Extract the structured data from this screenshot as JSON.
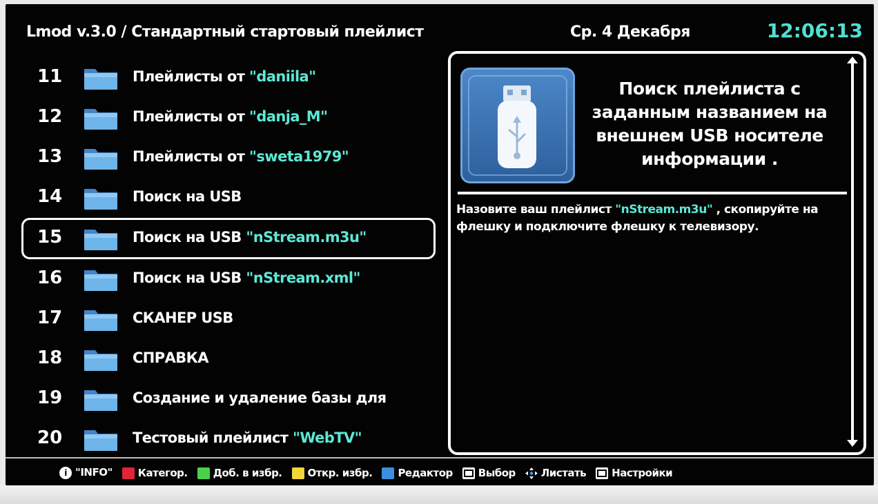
{
  "header": {
    "title": "Lmod v.3.0 / Стандартный стартовый плейлист",
    "date": "Ср. 4 Декабря",
    "time": "12:06:13"
  },
  "list": {
    "selected_index": 4,
    "items": [
      {
        "num": "11",
        "label": "Плейлисты от ",
        "highlight": "\"daniila\""
      },
      {
        "num": "12",
        "label": "Плейлисты от ",
        "highlight": "\"danja_M\""
      },
      {
        "num": "13",
        "label": "Плейлисты от ",
        "highlight": "\"sweta1979\""
      },
      {
        "num": "14",
        "label": "Поиск на USB",
        "highlight": ""
      },
      {
        "num": "15",
        "label": "Поиск на USB ",
        "highlight": "\"nStream.m3u\""
      },
      {
        "num": "16",
        "label": "Поиск на USB ",
        "highlight": "\"nStream.xml\""
      },
      {
        "num": "17",
        "label": "СКАНЕР USB",
        "highlight": ""
      },
      {
        "num": "18",
        "label": "СПРАВКА",
        "highlight": ""
      },
      {
        "num": "19",
        "label": "Создание и удаление базы для",
        "highlight": ""
      },
      {
        "num": "20",
        "label": "Тестовый плейлист ",
        "highlight": "\"WebTV\""
      }
    ]
  },
  "detail": {
    "title": "Поиск плейлиста с заданным названием на внешнем USB носителе информации .",
    "desc_before": "Назовите ваш плейлист ",
    "desc_highlight": "\"nStream.m3u\"",
    "desc_after": " , скопируйте на флешку и подключите флешку к телевизору."
  },
  "footer": [
    {
      "label": "\"INFO\"",
      "color": "#ffffff",
      "icon": "info-icon"
    },
    {
      "label": "Категор.",
      "color": "#e0243a",
      "icon": "red-key-icon"
    },
    {
      "label": "Доб. в избр.",
      "color": "#49d14b",
      "icon": "green-key-icon"
    },
    {
      "label": "Откр. избр.",
      "color": "#f1d63a",
      "icon": "yellow-key-icon"
    },
    {
      "label": "Редактор",
      "color": "#3b8fe0",
      "icon": "blue-key-icon"
    },
    {
      "label": "Выбор",
      "color": "#ffffff",
      "icon": "enter-key-icon"
    },
    {
      "label": "Листать",
      "color": "#ffffff",
      "icon": "dpad-icon"
    },
    {
      "label": "Настройки",
      "color": "#ffffff",
      "icon": "tools-key-icon"
    }
  ],
  "colors": {
    "highlight": "#5ce8d6",
    "clock": "#4ee0d0",
    "folder": "#5ea6e0"
  }
}
